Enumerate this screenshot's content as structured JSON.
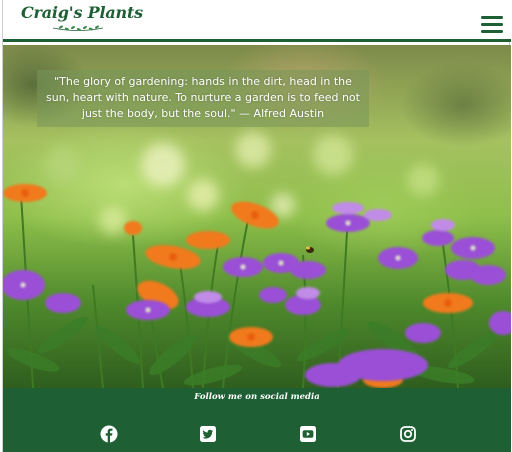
{
  "header": {
    "logo_text": "Craig's Plants",
    "menu_icon": "hamburger-menu-icon"
  },
  "hero": {
    "quote": "\"The glory of gardening: hands in the dirt, head in the sun, heart with nature. To nurture a garden is to feed not just the body, but the soul.\" — Alfred Austin"
  },
  "footer": {
    "follow_text": "Follow me on social media",
    "social_icons": [
      "facebook-icon",
      "twitter-icon",
      "youtube-icon",
      "instagram-icon"
    ]
  },
  "colors": {
    "brand_green": "#1e5f33",
    "white": "#ffffff"
  }
}
